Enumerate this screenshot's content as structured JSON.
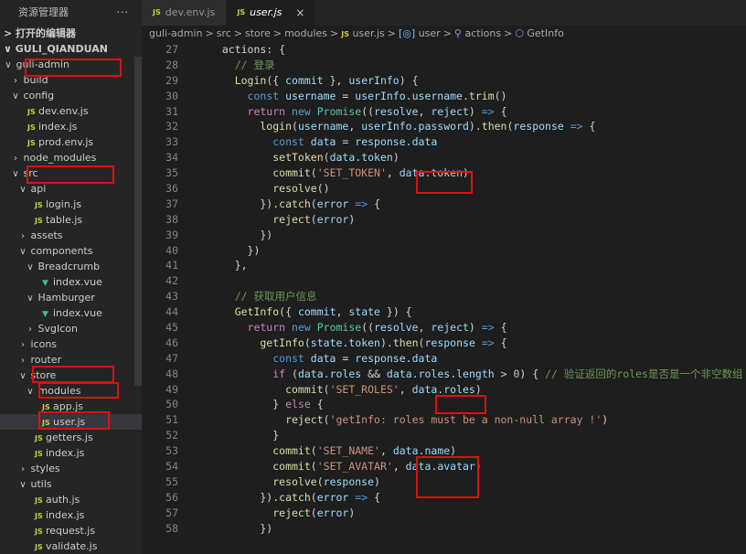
{
  "sidebar": {
    "title": "资源管理器",
    "more": "···",
    "open_editors": "打开的编辑器",
    "project": "GULI_QIANDUAN",
    "tree": [
      {
        "label": "guli-admin",
        "depth": 0,
        "type": "folder",
        "open": true
      },
      {
        "label": "build",
        "depth": 1,
        "type": "folder",
        "open": false
      },
      {
        "label": "config",
        "depth": 1,
        "type": "folder",
        "open": true
      },
      {
        "label": "dev.env.js",
        "depth": 2,
        "type": "js"
      },
      {
        "label": "index.js",
        "depth": 2,
        "type": "js"
      },
      {
        "label": "prod.env.js",
        "depth": 2,
        "type": "js"
      },
      {
        "label": "node_modules",
        "depth": 1,
        "type": "folder",
        "open": false
      },
      {
        "label": "src",
        "depth": 1,
        "type": "folder",
        "open": true
      },
      {
        "label": "api",
        "depth": 2,
        "type": "folder",
        "open": true
      },
      {
        "label": "login.js",
        "depth": 3,
        "type": "js"
      },
      {
        "label": "table.js",
        "depth": 3,
        "type": "js"
      },
      {
        "label": "assets",
        "depth": 2,
        "type": "folder",
        "open": false
      },
      {
        "label": "components",
        "depth": 2,
        "type": "folder",
        "open": true
      },
      {
        "label": "Breadcrumb",
        "depth": 3,
        "type": "folder",
        "open": true
      },
      {
        "label": "index.vue",
        "depth": 4,
        "type": "vue"
      },
      {
        "label": "Hamburger",
        "depth": 3,
        "type": "folder",
        "open": true
      },
      {
        "label": "index.vue",
        "depth": 4,
        "type": "vue"
      },
      {
        "label": "SvgIcon",
        "depth": 3,
        "type": "folder",
        "open": false
      },
      {
        "label": "icons",
        "depth": 2,
        "type": "folder",
        "open": false
      },
      {
        "label": "router",
        "depth": 2,
        "type": "folder",
        "open": false
      },
      {
        "label": "store",
        "depth": 2,
        "type": "folder",
        "open": true
      },
      {
        "label": "modules",
        "depth": 3,
        "type": "folder",
        "open": true
      },
      {
        "label": "app.js",
        "depth": 4,
        "type": "js"
      },
      {
        "label": "user.js",
        "depth": 4,
        "type": "js",
        "selected": true
      },
      {
        "label": "getters.js",
        "depth": 3,
        "type": "js"
      },
      {
        "label": "index.js",
        "depth": 3,
        "type": "js"
      },
      {
        "label": "styles",
        "depth": 2,
        "type": "folder",
        "open": false
      },
      {
        "label": "utils",
        "depth": 2,
        "type": "folder",
        "open": true
      },
      {
        "label": "auth.js",
        "depth": 3,
        "type": "js"
      },
      {
        "label": "index.js",
        "depth": 3,
        "type": "js"
      },
      {
        "label": "request.js",
        "depth": 3,
        "type": "js"
      },
      {
        "label": "validate.js",
        "depth": 3,
        "type": "js"
      }
    ]
  },
  "tabs": [
    {
      "label": "dev.env.js",
      "active": false
    },
    {
      "label": "user.js",
      "active": true,
      "close": "×"
    }
  ],
  "js_badge": "JS",
  "vue_badge": "▼",
  "breadcrumb": {
    "parts": [
      "guli-admin",
      "src",
      "store",
      "modules",
      "user.js",
      "user",
      "actions",
      "GetInfo"
    ],
    "sep": ">"
  },
  "code_lines": [
    {
      "n": "27",
      "t": [
        [
          "p",
          "  actions: {"
        ]
      ]
    },
    {
      "n": "28",
      "t": [
        [
          "cm",
          "    // 登录"
        ]
      ]
    },
    {
      "n": "29",
      "t": [
        [
          "f",
          "    Login"
        ],
        [
          "p",
          "({ "
        ],
        [
          "v",
          "commit"
        ],
        [
          "p",
          " }, "
        ],
        [
          "v",
          "userInfo"
        ],
        [
          "p",
          ") {"
        ]
      ]
    },
    {
      "n": "30",
      "t": [
        [
          "k",
          "      const "
        ],
        [
          "v",
          "username"
        ],
        [
          "p",
          " = "
        ],
        [
          "v",
          "userInfo"
        ],
        [
          "p",
          "."
        ],
        [
          "v",
          "username"
        ],
        [
          "p",
          "."
        ],
        [
          "f",
          "trim"
        ],
        [
          "p",
          "()"
        ]
      ]
    },
    {
      "n": "31",
      "t": [
        [
          "c",
          "      return "
        ],
        [
          "k",
          "new "
        ],
        [
          "t",
          "Promise"
        ],
        [
          "p",
          "(("
        ],
        [
          "v",
          "resolve"
        ],
        [
          "p",
          ", "
        ],
        [
          "v",
          "reject"
        ],
        [
          "p",
          ") "
        ],
        [
          "k",
          "=>"
        ],
        [
          "p",
          " {"
        ]
      ]
    },
    {
      "n": "32",
      "t": [
        [
          "f",
          "        login"
        ],
        [
          "p",
          "("
        ],
        [
          "v",
          "username"
        ],
        [
          "p",
          ", "
        ],
        [
          "v",
          "userInfo"
        ],
        [
          "p",
          "."
        ],
        [
          "v",
          "password"
        ],
        [
          "p",
          ")."
        ],
        [
          "f",
          "then"
        ],
        [
          "p",
          "("
        ],
        [
          "v",
          "response"
        ],
        [
          "k",
          " =>"
        ],
        [
          "p",
          " {"
        ]
      ]
    },
    {
      "n": "33",
      "t": [
        [
          "k",
          "          const "
        ],
        [
          "v",
          "data"
        ],
        [
          "p",
          " = "
        ],
        [
          "v",
          "response"
        ],
        [
          "p",
          "."
        ],
        [
          "v",
          "data"
        ]
      ]
    },
    {
      "n": "34",
      "t": [
        [
          "f",
          "          setToken"
        ],
        [
          "p",
          "("
        ],
        [
          "v",
          "data"
        ],
        [
          "p",
          "."
        ],
        [
          "v",
          "token"
        ],
        [
          "p",
          ")"
        ]
      ]
    },
    {
      "n": "35",
      "t": [
        [
          "f",
          "          commit"
        ],
        [
          "p",
          "("
        ],
        [
          "s",
          "'SET_TOKEN'"
        ],
        [
          "p",
          ", "
        ],
        [
          "v",
          "data"
        ],
        [
          "p",
          "."
        ],
        [
          "v",
          "token"
        ],
        [
          "p",
          ")"
        ]
      ]
    },
    {
      "n": "36",
      "t": [
        [
          "f",
          "          resolve"
        ],
        [
          "p",
          "()"
        ]
      ]
    },
    {
      "n": "37",
      "t": [
        [
          "p",
          "        })."
        ],
        [
          "f",
          "catch"
        ],
        [
          "p",
          "("
        ],
        [
          "v",
          "error"
        ],
        [
          "k",
          " =>"
        ],
        [
          "p",
          " {"
        ]
      ]
    },
    {
      "n": "38",
      "t": [
        [
          "f",
          "          reject"
        ],
        [
          "p",
          "("
        ],
        [
          "v",
          "error"
        ],
        [
          "p",
          ")"
        ]
      ]
    },
    {
      "n": "39",
      "t": [
        [
          "p",
          "        })"
        ]
      ]
    },
    {
      "n": "40",
      "t": [
        [
          "p",
          "      })"
        ]
      ]
    },
    {
      "n": "41",
      "t": [
        [
          "p",
          "    },"
        ]
      ]
    },
    {
      "n": "42",
      "t": []
    },
    {
      "n": "43",
      "t": [
        [
          "cm",
          "    // 获取用户信息"
        ]
      ]
    },
    {
      "n": "44",
      "t": [
        [
          "f",
          "    GetInfo"
        ],
        [
          "p",
          "({ "
        ],
        [
          "v",
          "commit"
        ],
        [
          "p",
          ", "
        ],
        [
          "v",
          "state"
        ],
        [
          "p",
          " }) {"
        ]
      ]
    },
    {
      "n": "45",
      "t": [
        [
          "c",
          "      return "
        ],
        [
          "k",
          "new "
        ],
        [
          "t",
          "Promise"
        ],
        [
          "p",
          "(("
        ],
        [
          "v",
          "resolve"
        ],
        [
          "p",
          ", "
        ],
        [
          "v",
          "reject"
        ],
        [
          "p",
          ") "
        ],
        [
          "k",
          "=>"
        ],
        [
          "p",
          " {"
        ]
      ]
    },
    {
      "n": "46",
      "t": [
        [
          "f",
          "        getInfo"
        ],
        [
          "p",
          "("
        ],
        [
          "v",
          "state"
        ],
        [
          "p",
          "."
        ],
        [
          "v",
          "token"
        ],
        [
          "p",
          ")."
        ],
        [
          "f",
          "then"
        ],
        [
          "p",
          "("
        ],
        [
          "v",
          "response"
        ],
        [
          "k",
          " =>"
        ],
        [
          "p",
          " {"
        ]
      ]
    },
    {
      "n": "47",
      "t": [
        [
          "k",
          "          const "
        ],
        [
          "v",
          "data"
        ],
        [
          "p",
          " = "
        ],
        [
          "v",
          "response"
        ],
        [
          "p",
          "."
        ],
        [
          "v",
          "data"
        ]
      ]
    },
    {
      "n": "48",
      "t": [
        [
          "c",
          "          if "
        ],
        [
          "p",
          "("
        ],
        [
          "v",
          "data"
        ],
        [
          "p",
          "."
        ],
        [
          "v",
          "roles"
        ],
        [
          "p",
          " && "
        ],
        [
          "v",
          "data"
        ],
        [
          "p",
          "."
        ],
        [
          "v",
          "roles"
        ],
        [
          "p",
          "."
        ],
        [
          "v",
          "length"
        ],
        [
          "p",
          " > "
        ],
        [
          "n",
          "0"
        ],
        [
          "p",
          ") { "
        ],
        [
          "cm",
          "// 验证返回的roles是否是一个非空数组"
        ]
      ]
    },
    {
      "n": "49",
      "t": [
        [
          "f",
          "            commit"
        ],
        [
          "p",
          "("
        ],
        [
          "s",
          "'SET_ROLES'"
        ],
        [
          "p",
          ", "
        ],
        [
          "v",
          "data"
        ],
        [
          "p",
          "."
        ],
        [
          "v",
          "roles"
        ],
        [
          "p",
          ")"
        ]
      ]
    },
    {
      "n": "50",
      "t": [
        [
          "p",
          "          } "
        ],
        [
          "c",
          "else"
        ],
        [
          "p",
          " {"
        ]
      ]
    },
    {
      "n": "51",
      "t": [
        [
          "f",
          "            reject"
        ],
        [
          "p",
          "("
        ],
        [
          "s",
          "'getInfo: roles must be a non-null array !'"
        ],
        [
          "p",
          ")"
        ]
      ]
    },
    {
      "n": "52",
      "t": [
        [
          "p",
          "          }"
        ]
      ]
    },
    {
      "n": "53",
      "t": [
        [
          "f",
          "          commit"
        ],
        [
          "p",
          "("
        ],
        [
          "s",
          "'SET_NAME'"
        ],
        [
          "p",
          ", "
        ],
        [
          "v",
          "data"
        ],
        [
          "p",
          "."
        ],
        [
          "v",
          "name"
        ],
        [
          "p",
          ")"
        ]
      ]
    },
    {
      "n": "54",
      "t": [
        [
          "f",
          "          commit"
        ],
        [
          "p",
          "("
        ],
        [
          "s",
          "'SET_AVATAR'"
        ],
        [
          "p",
          ", "
        ],
        [
          "v",
          "data"
        ],
        [
          "p",
          "."
        ],
        [
          "v",
          "avatar"
        ],
        [
          "p",
          ")"
        ]
      ]
    },
    {
      "n": "55",
      "t": [
        [
          "f",
          "          resolve"
        ],
        [
          "p",
          "("
        ],
        [
          "v",
          "response"
        ],
        [
          "p",
          ")"
        ]
      ]
    },
    {
      "n": "56",
      "t": [
        [
          "p",
          "        })."
        ],
        [
          "f",
          "catch"
        ],
        [
          "p",
          "("
        ],
        [
          "v",
          "error"
        ],
        [
          "k",
          " =>"
        ],
        [
          "p",
          " {"
        ]
      ]
    },
    {
      "n": "57",
      "t": [
        [
          "f",
          "          reject"
        ],
        [
          "p",
          "("
        ],
        [
          "v",
          "error"
        ],
        [
          "p",
          ")"
        ]
      ]
    },
    {
      "n": "58",
      "t": [
        [
          "p",
          "        })"
        ]
      ]
    }
  ],
  "colors": {
    "highlight": "#e01010",
    "editor_bg": "#1e1e1e",
    "sidebar_bg": "#252526"
  }
}
